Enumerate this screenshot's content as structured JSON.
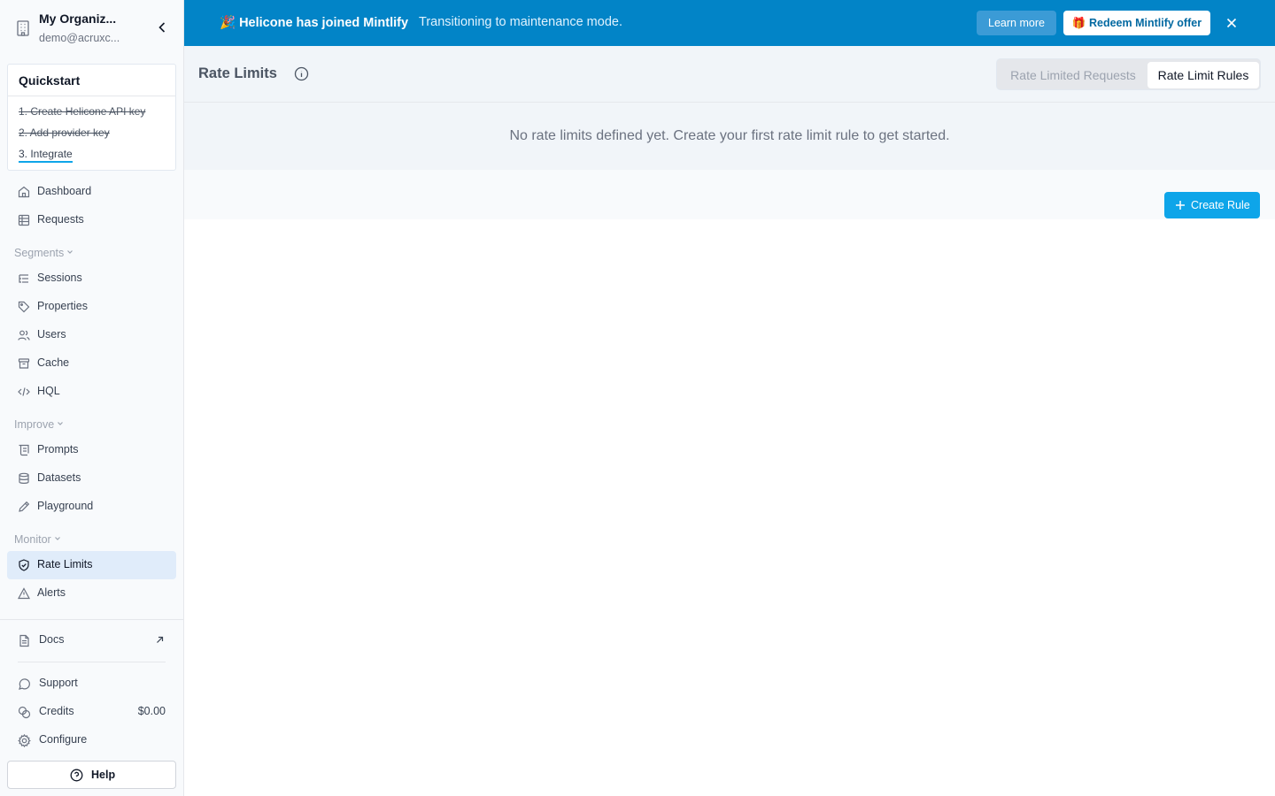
{
  "org": {
    "name": "My Organiz...",
    "email": "demo@acruxc..."
  },
  "quickstart": {
    "title": "Quickstart",
    "steps": [
      {
        "label": "1. Create Helicone API key",
        "done": true
      },
      {
        "label": "2. Add provider key",
        "done": true
      },
      {
        "label": "3. Integrate",
        "done": false
      }
    ]
  },
  "nav": {
    "dashboard": "Dashboard",
    "requests": "Requests",
    "segments": "Segments",
    "sessions": "Sessions",
    "properties": "Properties",
    "users": "Users",
    "cache": "Cache",
    "hql": "HQL",
    "improve": "Improve",
    "prompts": "Prompts",
    "datasets": "Datasets",
    "playground": "Playground",
    "monitor": "Monitor",
    "rate_limits": "Rate Limits",
    "alerts": "Alerts"
  },
  "footer": {
    "docs": "Docs",
    "support": "Support",
    "credits": "Credits",
    "credits_value": "$0.00",
    "configure": "Configure",
    "help": "Help"
  },
  "banner": {
    "title": "🎉 Helicone has joined Mintlify",
    "message": "Transitioning to maintenance mode.",
    "learn_more": "Learn more",
    "redeem": "🎁 Redeem Mintlify offer"
  },
  "header": {
    "title": "Rate Limits",
    "tabs": [
      "Rate Limited Requests",
      "Rate Limit Rules"
    ]
  },
  "empty_state": "No rate limits defined yet. Create your first rate limit rule to get started.",
  "create_rule": "Create Rule",
  "colors": {
    "accent": "#0ea5e9",
    "banner": "#0284c7",
    "active_nav": "#e0ecfa"
  }
}
